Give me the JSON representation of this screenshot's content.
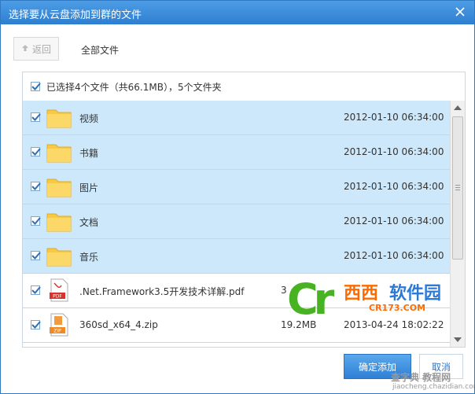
{
  "dialog": {
    "title": "选择要从云盘添加到群的文件",
    "back_label": "返回",
    "breadcrumb": "全部文件",
    "summary": "已选择4个文件（共66.1MB），5个文件夹",
    "ok_label": "确定添加",
    "cancel_label": "取消"
  },
  "files": [
    {
      "name": "视频",
      "size": "",
      "time": "2012-01-10 06:34:00",
      "type": "folder",
      "checked": true
    },
    {
      "name": "书籍",
      "size": "",
      "time": "2012-01-10 06:34:00",
      "type": "folder",
      "checked": true
    },
    {
      "name": "图片",
      "size": "",
      "time": "2012-01-10 06:34:00",
      "type": "folder",
      "checked": true
    },
    {
      "name": "文档",
      "size": "",
      "time": "2012-01-10 06:34:00",
      "type": "folder",
      "checked": true
    },
    {
      "name": "音乐",
      "size": "",
      "time": "2012-01-10 06:34:00",
      "type": "folder",
      "checked": true
    },
    {
      "name": ".Net.Framework3.5开发技术详解.pdf",
      "size": "3",
      "time": "",
      "type": "pdf",
      "checked": true
    },
    {
      "name": "360sd_x64_4.zip",
      "size": "19.2MB",
      "time": "2013-04-24 18:02:22",
      "type": "zip",
      "checked": true
    }
  ],
  "icons": {
    "close": "close-icon",
    "back": "arrow-up-icon",
    "folder": "folder-icon",
    "pdf": "pdf-file-icon",
    "zip": "zip-file-icon"
  },
  "watermark": {
    "logo": "Cr",
    "cn1": "西西",
    "cn2": "软件园",
    "url": "CR173.COM",
    "site": "查字典 教程网",
    "site_url": "jiaocheng.chazidian.com"
  },
  "colors": {
    "accent": "#2f7fd0",
    "selected_row": "#cde8fa"
  }
}
